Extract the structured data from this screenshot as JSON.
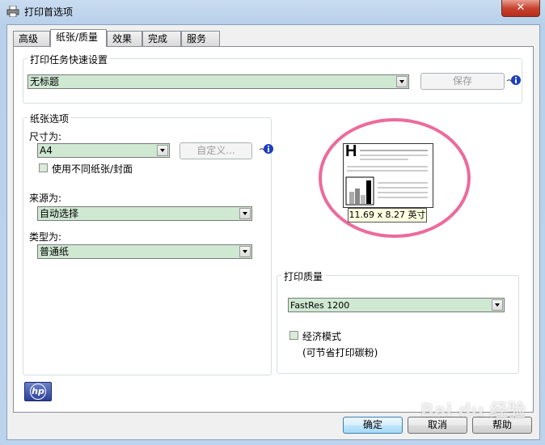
{
  "window": {
    "title": "打印首选项",
    "close": "✕"
  },
  "tabs": [
    {
      "label": "高级"
    },
    {
      "label": "纸张/质量"
    },
    {
      "label": "效果"
    },
    {
      "label": "完成"
    },
    {
      "label": "服务"
    }
  ],
  "quick_set": {
    "legend": "打印任务快速设置",
    "value": "无标题",
    "save_label": "保存"
  },
  "paper": {
    "legend": "纸张选项",
    "size_label": "尺寸为:",
    "size_value": "A4",
    "custom_label": "自定义...",
    "diff_paper_label": "使用不同纸张/封面",
    "source_label": "来源为:",
    "source_value": "自动选择",
    "type_label": "类型为:",
    "type_value": "普通纸"
  },
  "preview": {
    "letter": "H",
    "size_text": "11.69 x 8.27 英寸"
  },
  "quality": {
    "legend": "打印质量",
    "value": "FastRes 1200",
    "economode_label": "经济模式",
    "economode_note": "(可节省打印碳粉)"
  },
  "logo_text": "hp",
  "buttons": {
    "ok": "确定",
    "cancel": "取消",
    "help": "帮助"
  },
  "watermark": "Bai du 经验",
  "colors": {
    "highlight_ellipse": "#ec6b9b",
    "combo_bg": "#cfe8d2"
  },
  "icons": [
    "printer-icon",
    "info-icon",
    "hp-logo-icon",
    "chevron-down-icon"
  ]
}
